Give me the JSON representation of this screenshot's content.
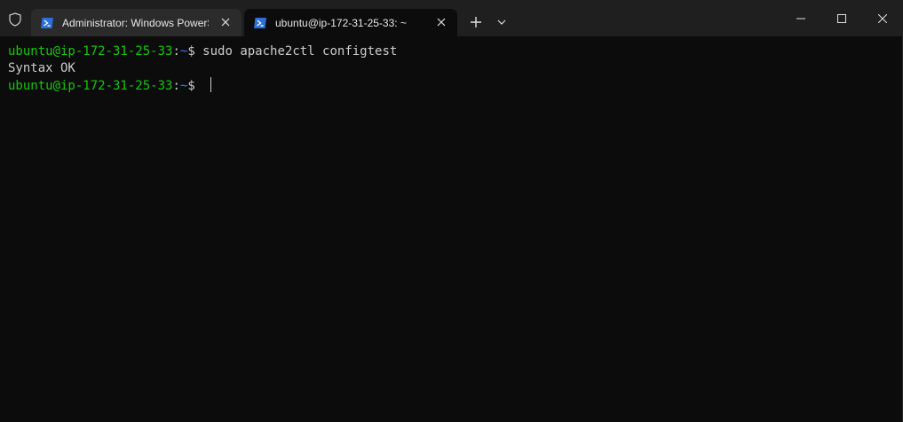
{
  "window": {
    "tabs": [
      {
        "title": "Administrator: Windows PowerShell",
        "icon": "powershell-icon",
        "active": false
      },
      {
        "title": "ubuntu@ip-172-31-25-33: ~",
        "icon": "powershell-icon",
        "active": true
      }
    ],
    "new_tab_label": "+",
    "controls": [
      "minimize-icon",
      "maximize-icon",
      "close-icon"
    ]
  },
  "terminal": {
    "lines": [
      {
        "user_host": "ubuntu@ip-172-31-25-33",
        "sep": ":",
        "path": "~",
        "prompt": "$ ",
        "command": "sudo apache2ctl configtest"
      },
      {
        "output": "Syntax OK"
      },
      {
        "user_host": "ubuntu@ip-172-31-25-33",
        "sep": ":",
        "path": "~",
        "prompt": "$ ",
        "command": ""
      }
    ]
  },
  "colors": {
    "background": "#0c0c0c",
    "titlebar": "#1f1f1f",
    "prompt_user": "#16c60c",
    "prompt_path": "#3b78ff",
    "text": "#cccccc",
    "powershell_icon": "#2c6fd8"
  }
}
